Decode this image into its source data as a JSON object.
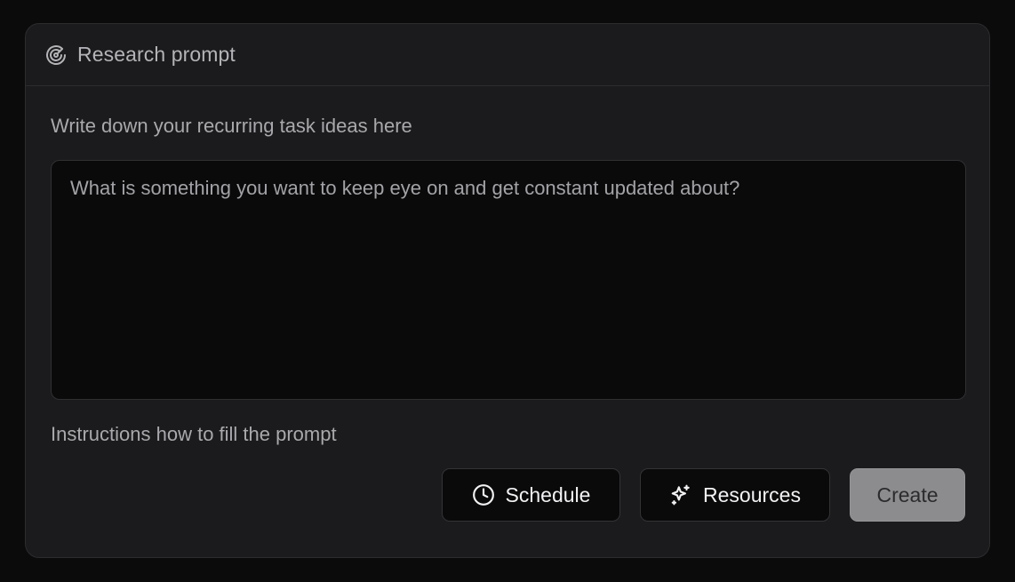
{
  "header": {
    "title": "Research prompt",
    "icon": "radar-icon"
  },
  "form": {
    "section_label": "Write down your recurring task ideas here",
    "prompt_value": "",
    "prompt_placeholder": "What is something you want to keep eye on and get constant updated about?",
    "instructions": "Instructions how to fill the prompt"
  },
  "actions": {
    "schedule_label": "Schedule",
    "schedule_icon": "clock-icon",
    "resources_label": "Resources",
    "resources_icon": "sparkles-icon",
    "create_label": "Create"
  },
  "colors": {
    "page_bg": "#0b0b0c",
    "panel_bg": "#1b1b1d",
    "input_bg": "#0a0a0b",
    "create_bg": "#8c8c8f"
  }
}
